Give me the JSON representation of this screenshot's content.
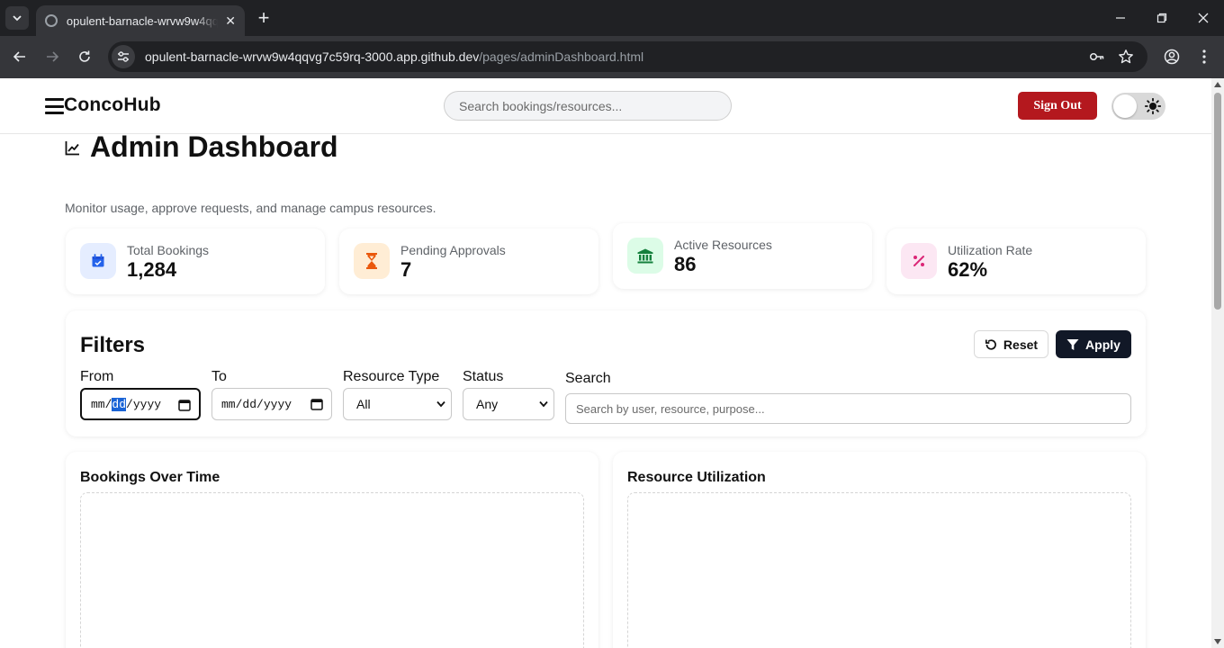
{
  "browser": {
    "tab_title": "opulent-barnacle-wrvw9w4qqvg7c59rq-3000.app.github.dev/pages/adminDashboard.html",
    "url_host": "opulent-barnacle-wrvw9w4qqvg7c59rq-3000.app.github.dev",
    "url_path": "/pages/adminDashboard.html"
  },
  "header": {
    "brand": "ConcoHub",
    "search_placeholder": "Search bookings/resources...",
    "sign_out_label": "Sign Out"
  },
  "page": {
    "title": "Admin Dashboard",
    "subtitle": "Monitor usage, approve requests, and manage campus resources."
  },
  "stats": [
    {
      "label": "Total Bookings",
      "value": "1,284",
      "icon": "calendar-icon",
      "color": "#2563eb",
      "bg": "#e5edff"
    },
    {
      "label": "Pending Approvals",
      "value": "7",
      "icon": "hourglass-icon",
      "color": "#ea580c",
      "bg": "#ffedd5"
    },
    {
      "label": "Active Resources",
      "value": "86",
      "icon": "bank-icon",
      "color": "#15803d",
      "bg": "#dcfce7"
    },
    {
      "label": "Utilization Rate",
      "value": "62%",
      "icon": "percent-icon",
      "color": "#db2777",
      "bg": "#fce7f3"
    }
  ],
  "filters": {
    "title": "Filters",
    "reset_label": "Reset",
    "apply_label": "Apply",
    "from_label": "From",
    "to_label": "To",
    "resource_type_label": "Resource Type",
    "status_label": "Status",
    "search_label": "Search",
    "date_mm": "mm",
    "date_dd": "dd",
    "date_yyyy": "yyyy",
    "resource_type_value": "All",
    "status_value": "Any",
    "search_placeholder": "Search by user, resource, purpose..."
  },
  "charts": {
    "bookings_title": "Bookings Over Time",
    "utilization_title": "Resource Utilization"
  }
}
